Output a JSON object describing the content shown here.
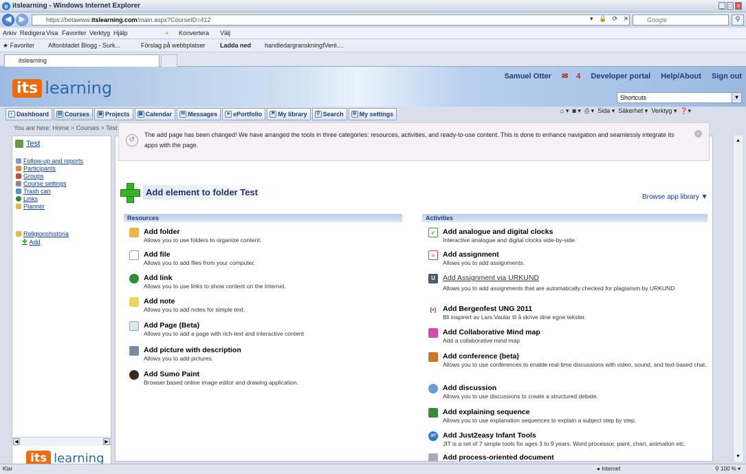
{
  "window": {
    "title": "itslearning - Windows Internet Explorer"
  },
  "browser": {
    "url_prefix": "https://betawww.",
    "url_domain": "itslearning.com",
    "url_path": "/main.aspx?CourseID=412",
    "search_placeholder": "Google",
    "menu": [
      "Arkiv",
      "Redigera",
      "Visa",
      "Favoriter",
      "Verktyg",
      "Hjälp"
    ],
    "menu_extra": [
      "Konvertera",
      "Välj"
    ],
    "favorites_label": "Favoriter",
    "favorites": [
      "Aftonbladet Blogg - Surk...",
      "Förslag på webbplatser",
      "Ladda ned",
      "handledargranskningfVeré...."
    ],
    "tab_title": "itslearning",
    "commands": [
      "Sida",
      "Säkerhet",
      "Verktyg"
    ]
  },
  "header": {
    "logo_its": "its",
    "logo_learning": "learning",
    "user_name": "Samuel Otter",
    "message_count": "4",
    "links": [
      "Developer portal",
      "Help/About",
      "Sign out"
    ],
    "shortcuts_value": "Shortcuts"
  },
  "nav": [
    {
      "label": "Dashboard",
      "icon": "dashboard-icon"
    },
    {
      "label": "Courses",
      "icon": "courses-icon",
      "active": true
    },
    {
      "label": "Projects",
      "icon": "projects-icon"
    },
    {
      "label": "Calendar",
      "icon": "calendar-icon"
    },
    {
      "label": "Messages",
      "icon": "messages-icon"
    },
    {
      "label": "ePortfolio",
      "icon": "eportfolio-icon"
    },
    {
      "label": "My library",
      "icon": "library-icon"
    },
    {
      "label": "Search",
      "icon": "search-icon"
    },
    {
      "label": "My settings",
      "icon": "settings-icon"
    }
  ],
  "breadcrumb": "You are here: Home > Courses > Test > Add element to folder Test",
  "sidebar": {
    "course": "Test",
    "items": [
      "Follow-up and reports",
      "Participants",
      "Groups",
      "Course settings",
      "Trash can",
      "Links",
      "Planner"
    ],
    "folder": "Religionshistoria",
    "add": "Add"
  },
  "notice": "The add page has been changed! We have arranged the tools in three categories: resources, activities, and ready-to-use content. This is done to enhance navigation and seamlessly integrate its apps with the page.",
  "add_title": "Add element to folder Test",
  "browse_label": "Browse app library ▼",
  "resources": {
    "header": "Resources",
    "items": [
      {
        "title": "Add folder",
        "desc": "Allows you to use folders to organize content."
      },
      {
        "title": "Add file",
        "desc": "Allows you to add files from your computer."
      },
      {
        "title": "Add link",
        "desc": "Allows you to use links to show content on the Internet."
      },
      {
        "title": "Add note",
        "desc": "Allows you to add notes for simple text."
      },
      {
        "title": "Add Page (Beta)",
        "desc": "Allows you to add a page with rich-text and interactive content"
      },
      {
        "title": "Add picture with description",
        "desc": "Allows you to add pictures."
      },
      {
        "title": "Add Sumo Paint",
        "desc": "Browser based online image editor and drawing application."
      }
    ]
  },
  "activities": {
    "header": "Activities",
    "items": [
      {
        "title": "Add analogue and digital clocks",
        "desc": "Interactive analogue and digital clocks side-by-side."
      },
      {
        "title": "Add assignment",
        "desc": "Allows you to add assignments."
      },
      {
        "title": "Add Assignment via URKUND",
        "desc": "Allows you to add assignments that are automatically checked for plagiarism by URKUND"
      },
      {
        "title": "Add Bergenfest UNG 2011",
        "desc": "Bli inspirert av Lars Vaular til å skrive dine egne tekster."
      },
      {
        "title": "Add Collaborative Mind map",
        "desc": "Add a collaborative mind map"
      },
      {
        "title": "Add conference (beta)",
        "desc": "Allows you to use conferences to enable real-time discussions with video, sound, and text-based chat."
      },
      {
        "title": "Add discussion",
        "desc": "Allows you to use discussions to create a structured debate."
      },
      {
        "title": "Add explaining sequence",
        "desc": "Allows you to use explanation sequences to explain a subject step by step."
      },
      {
        "title": "Add Just2easy Infant Tools",
        "desc": "JIT is a set of 7 simple tools for ages 3 to 9 years. Word processor, paint, chart, animation etc."
      },
      {
        "title": "Add process-oriented document",
        "desc": ""
      }
    ]
  },
  "status": {
    "left": "Klar",
    "zone": "Internet",
    "zoom": "100 %"
  },
  "colors": {
    "accent": "#ec6a10",
    "link": "#0a3ea8",
    "header_text": "#1d3d78"
  }
}
